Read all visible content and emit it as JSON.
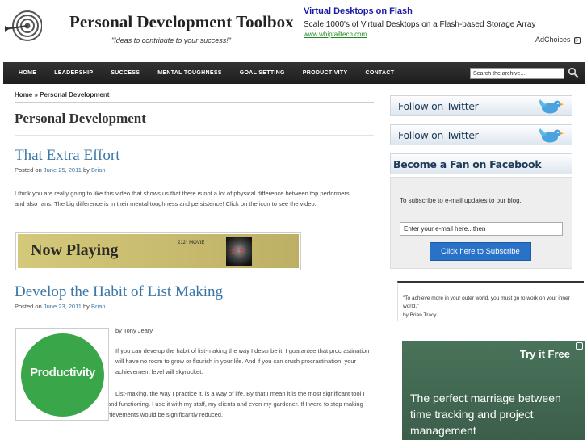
{
  "header": {
    "site_title": "Personal Development Toolbox",
    "tagline": "\"Ideas to contribute to your success!\"",
    "ad": {
      "title": "Virtual Desktops on Flash",
      "description": "Scale 1000's of Virtual Desktops on a Flash-based Storage Array",
      "url": "www.whiptailtech.com",
      "adchoices": "AdChoices"
    }
  },
  "nav": {
    "items": [
      "HOME",
      "LEADERSHIP",
      "SUCCESS",
      "MENTAL TOUGHNESS",
      "GOAL SETTING",
      "PRODUCTIVITY",
      "CONTACT"
    ],
    "search_value": "Search the archive..."
  },
  "main": {
    "breadcrumb": "Home » Personal Development",
    "page_title": "Personal Development",
    "posts": [
      {
        "title": "That Extra Effort",
        "meta_prefix": "Posted on",
        "date": "June 25, 2011",
        "meta_by": "by",
        "author": "Brian",
        "body": "I think you are really going to like this video that shows us that there is not a lot of physical difference between top performers and also rans. The big difference is in their mental toughness and persistence! Click on the icon to see the video.",
        "banner_text": "Now Playing",
        "banner_movie": "212° MOVIE",
        "banner_poster": "212"
      },
      {
        "title": "Develop the Habit of List Making",
        "meta_prefix": "Posted on",
        "date": "June 23, 2011",
        "meta_by": "by",
        "author": "Brian",
        "image_text": "Productivity",
        "byline": "by Tony Jeary",
        "para1": "If you can develop the habit of list-making the way I describe it, I guarantee that procrastination will have no room to grow or flourish in your life. And if you can crush procrastination, your achievement level will skyrocket.",
        "para2": "List-making, the way I practice it, is a way of life. By that I mean it is the most significant tool I use to keep my entire life together and functioning. I use it with my staff, my clients and even my gardener. If I were to stop making and using lists, my success and achievements would be significantly reduced."
      }
    ]
  },
  "sidebar": {
    "twitter_label": "Follow on Twitter",
    "facebook_label": "Become a Fan on Facebook",
    "subscribe_text": "To subscribe to e-mail updates to our blog,",
    "email_value": "Enter your e-mail here...then",
    "subscribe_button": "Click here to Subscribe",
    "quote": "\"To achieve more in your outer world. you must go to work on your inner world.\"",
    "quote_author": "by Brian Tracy",
    "ad_try": "Try it Free",
    "ad_headline": "The perfect marriage between time tracking and project management"
  },
  "colors": {
    "link": "#3a77a8",
    "nav_bg": "#2a2a2a",
    "subscribe_btn": "#2a72c8",
    "productivity_green": "#3aa64a"
  }
}
